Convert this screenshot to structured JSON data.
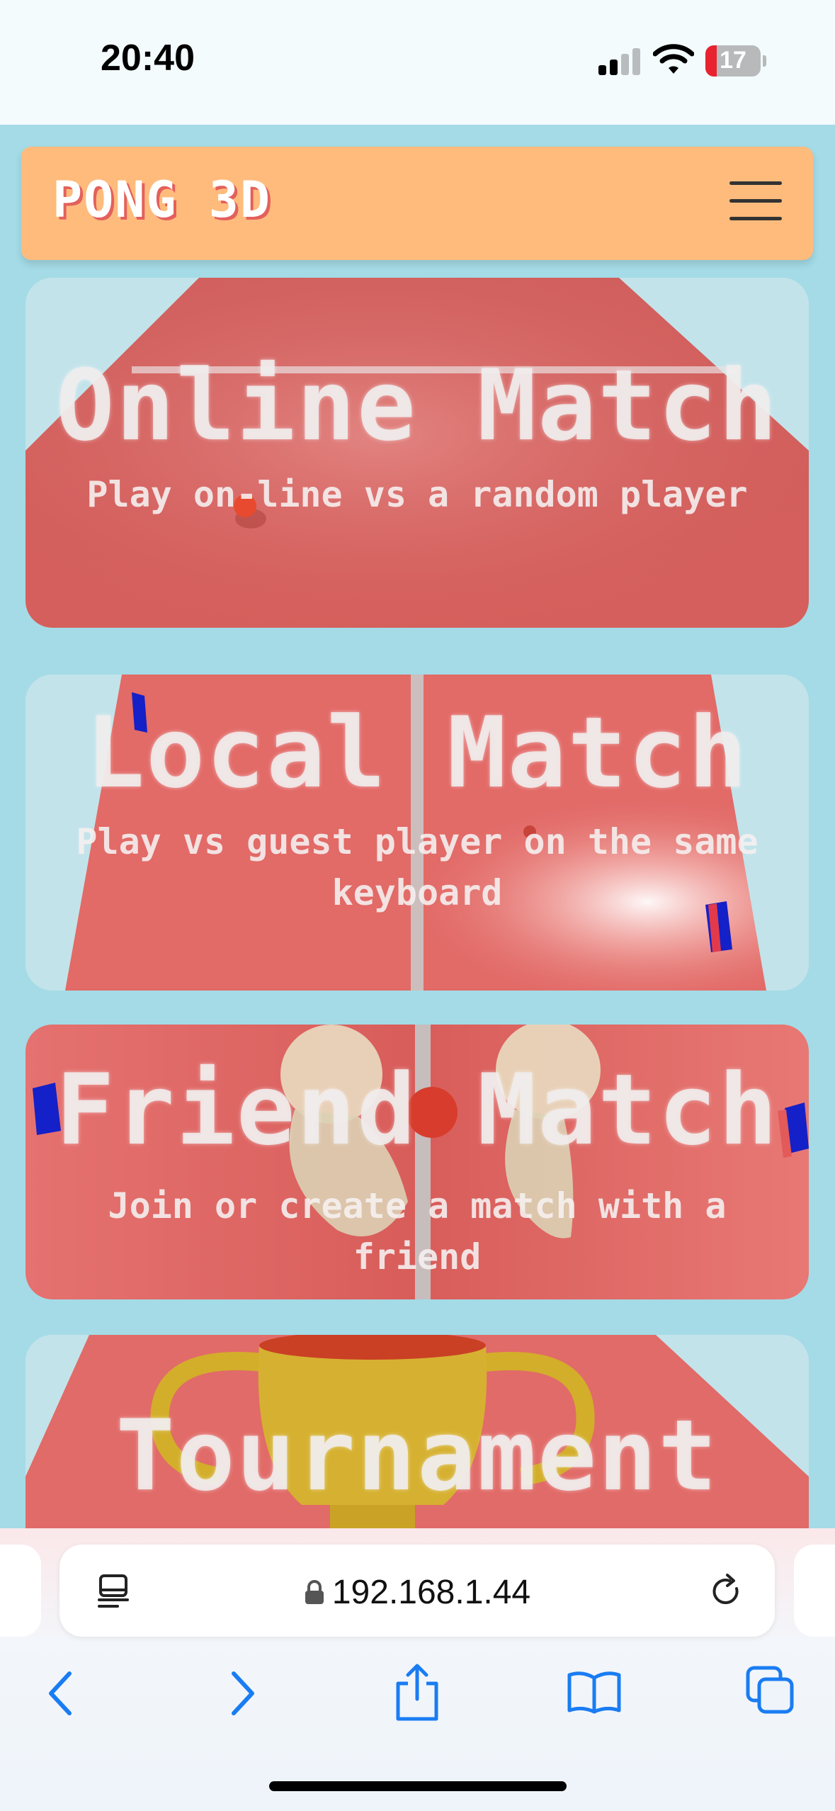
{
  "status_bar": {
    "time": "20:40",
    "battery_level": "17",
    "icons": [
      "cellular-signal-icon",
      "wifi-icon",
      "battery-icon"
    ]
  },
  "header": {
    "logo_text": "PONG 3D",
    "menu_icon": "hamburger-menu-icon",
    "colors": {
      "background": "#ffbb7c",
      "logo_shadow": "#e3605c"
    }
  },
  "modes": [
    {
      "title": "Online Match",
      "description": "Play on-line vs a random player"
    },
    {
      "title": "Local Match",
      "description": "Play vs guest player on the same keyboard"
    },
    {
      "title": "Friend Match",
      "description": "Join or create a match with a friend"
    },
    {
      "title": "Tournament",
      "description": ""
    }
  ],
  "browser": {
    "url": "192.168.1.44",
    "icons": [
      "page-menu-icon",
      "lock-icon",
      "reload-icon",
      "back-icon",
      "forward-icon",
      "share-icon",
      "bookmarks-icon",
      "tabs-icon"
    ],
    "accent": "#1a7cf2"
  },
  "colors": {
    "page_background": "#a4dbe6",
    "table": "#d9605d"
  }
}
